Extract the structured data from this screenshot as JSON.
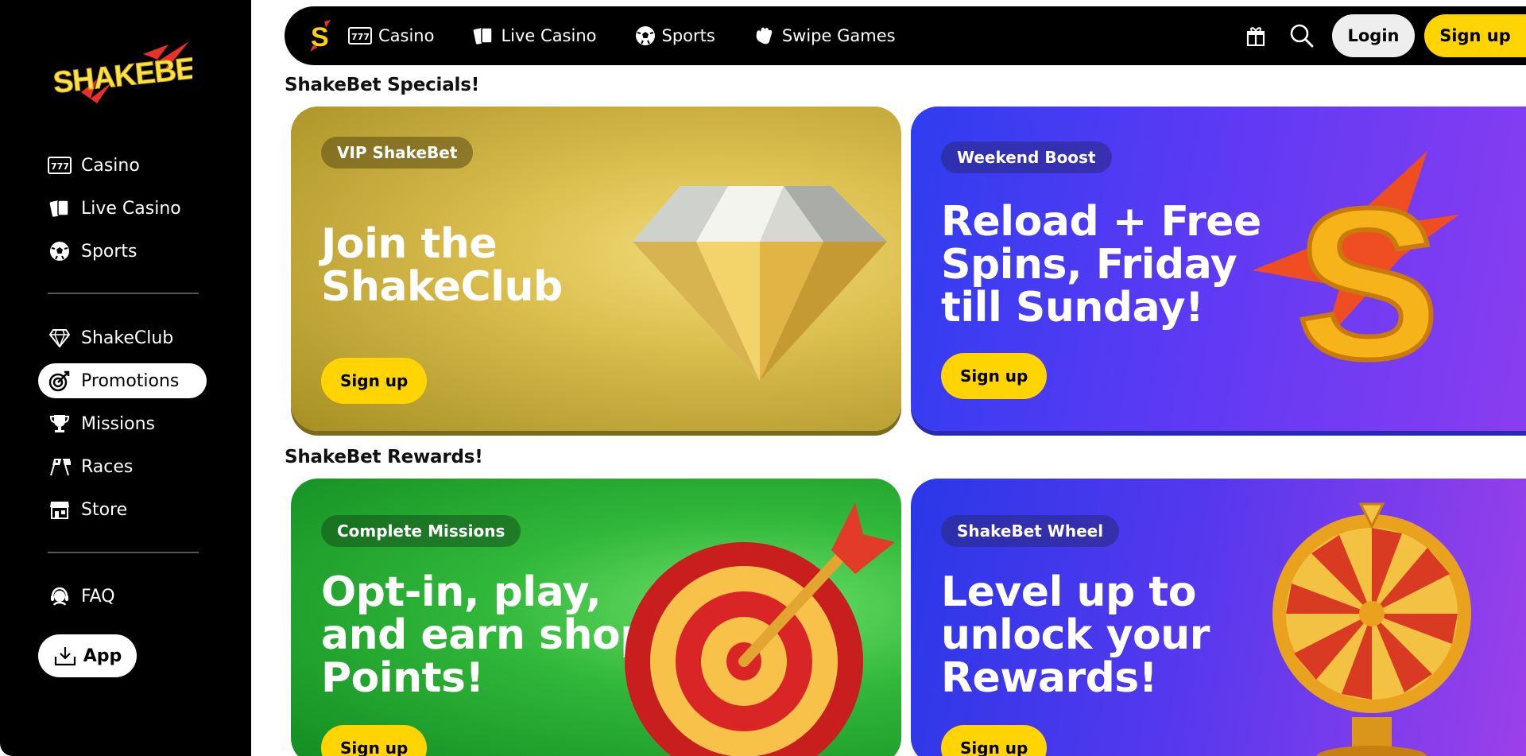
{
  "brand": {
    "name": "SHAKEBET"
  },
  "sidebar": {
    "primary": [
      {
        "label": "Casino",
        "icon": "slot-machine-icon"
      },
      {
        "label": "Live Casino",
        "icon": "playing-cards-icon"
      },
      {
        "label": "Sports",
        "icon": "soccer-ball-icon"
      }
    ],
    "secondary": [
      {
        "label": "ShakeClub",
        "icon": "diamond-icon"
      },
      {
        "label": "Promotions",
        "icon": "target-icon",
        "active": true
      },
      {
        "label": "Missions",
        "icon": "trophy-icon"
      },
      {
        "label": "Races",
        "icon": "race-flags-icon"
      },
      {
        "label": "Store",
        "icon": "store-icon"
      }
    ],
    "faq": {
      "label": "FAQ",
      "icon": "support-agent-icon"
    },
    "app": {
      "label": "App",
      "icon": "download-icon"
    }
  },
  "topbar": {
    "links": [
      {
        "label": "Casino",
        "icon": "slot-machine-icon"
      },
      {
        "label": "Live Casino",
        "icon": "playing-cards-icon"
      },
      {
        "label": "Sports",
        "icon": "soccer-ball-icon"
      },
      {
        "label": "Swipe Games",
        "icon": "swipe-hand-icon"
      }
    ],
    "login_label": "Login",
    "signup_label": "Sign up"
  },
  "sections": [
    {
      "title": "ShakeBet Specials!",
      "cards": [
        {
          "badge": "VIP ShakeBet",
          "headline": [
            "Join the",
            "ShakeClub"
          ],
          "cta": "Sign up"
        },
        {
          "badge": "Weekend Boost",
          "headline": [
            "Reload + Free",
            "Spins, Friday",
            "till Sunday!"
          ],
          "cta": "Sign up"
        }
      ]
    },
    {
      "title": "ShakeBet Rewards!",
      "cards": [
        {
          "badge": "Complete Missions",
          "headline": [
            "Opt-in, play,",
            "and earn shop",
            "Points!"
          ],
          "cta": "Sign up"
        },
        {
          "badge": "ShakeBet Wheel",
          "headline": [
            "Level up to",
            "unlock your",
            "Rewards!"
          ],
          "cta": "Sign up"
        }
      ]
    }
  ],
  "colors": {
    "accent": "#ffd400",
    "sidebar_bg": "#000000"
  }
}
